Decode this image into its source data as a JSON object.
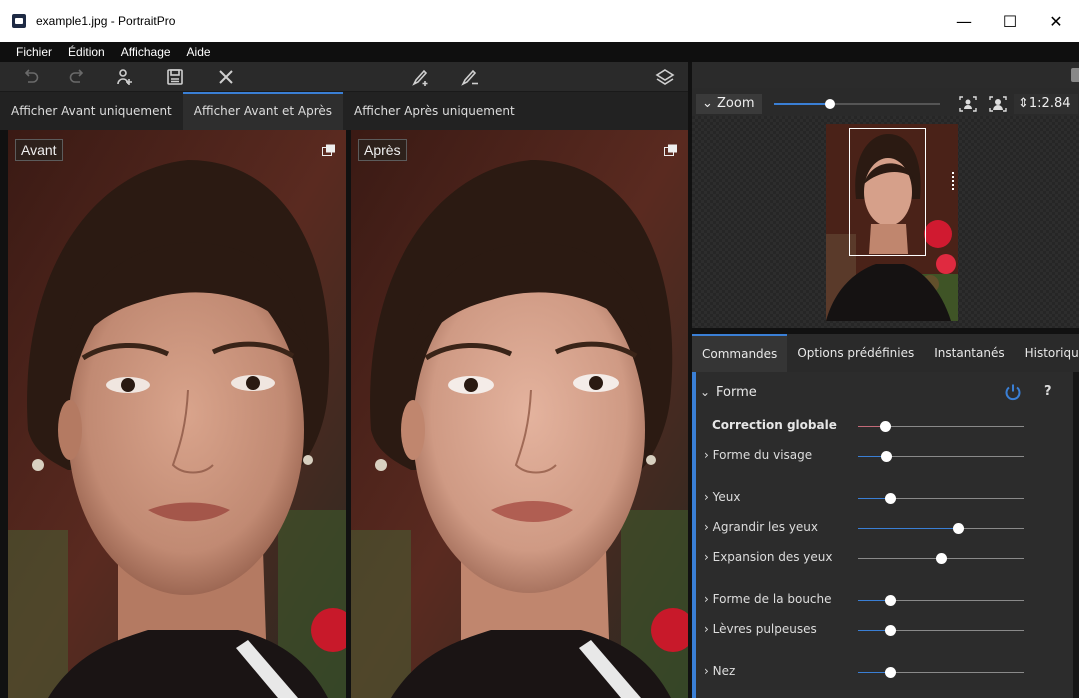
{
  "window": {
    "title": "example1.jpg - PortraitPro",
    "minimize": "—",
    "maximize": "☐",
    "close": "✕"
  },
  "menu": [
    {
      "label": "Fichier"
    },
    {
      "label": "Édition"
    },
    {
      "label": "Affichage"
    },
    {
      "label": "Aide"
    }
  ],
  "toolbar": {
    "icons": [
      "undo-icon",
      "redo-icon",
      "add-person-icon",
      "save-icon",
      "close-icon",
      "brush-add-icon",
      "brush-remove-icon",
      "layers-icon"
    ]
  },
  "view_tabs": [
    {
      "label": "Afficher Avant uniquement",
      "active": false
    },
    {
      "label": "Afficher Avant et Après",
      "active": true
    },
    {
      "label": "Afficher Après uniquement",
      "active": false
    }
  ],
  "panes": {
    "before_label": "Avant",
    "after_label": "Après"
  },
  "navigator": {
    "zoom_label": "Zoom",
    "zoom_value": "1:2.84",
    "zoom_slider_fraction": 0.34
  },
  "command_tabs": [
    {
      "label": "Commandes",
      "active": true
    },
    {
      "label": "Options prédéfinies",
      "active": false
    },
    {
      "label": "Instantanés",
      "active": false
    },
    {
      "label": "Historique",
      "active": false
    }
  ],
  "section": {
    "title": "Forme",
    "help": "?"
  },
  "sliders": [
    {
      "label": "Correction globale",
      "value": 0.16,
      "bold": true
    },
    {
      "label": "Forme du visage",
      "value": 0.17
    },
    {
      "label": "Yeux",
      "value": 0.19
    },
    {
      "label": "Agrandir les yeux",
      "value": 0.6
    },
    {
      "label": "Expansion des yeux",
      "value": 0.5
    },
    {
      "label": "Forme de la bouche",
      "value": 0.19
    },
    {
      "label": "Lèvres pulpeuses",
      "value": 0.19
    },
    {
      "label": "Nez",
      "value": 0.19
    }
  ],
  "colors": {
    "accent": "#3a7fd5",
    "global_fill": "#c46a78",
    "power_icon": "#3a7fd5"
  }
}
